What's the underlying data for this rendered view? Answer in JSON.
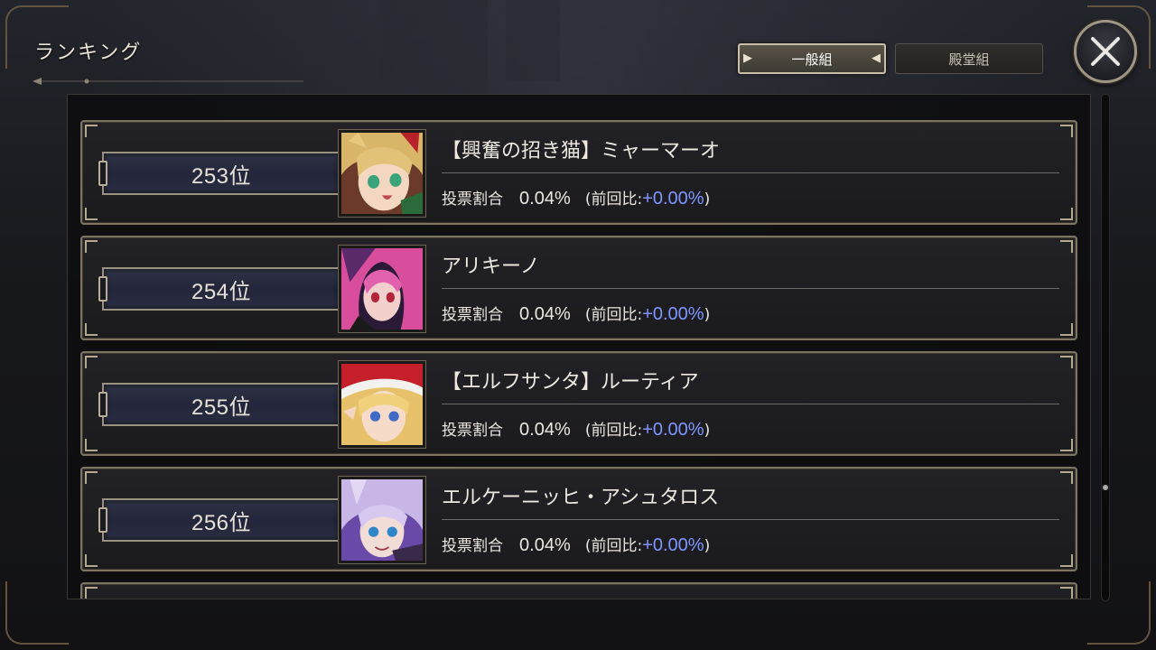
{
  "header": {
    "title": "ランキング",
    "tabs": [
      {
        "label": "一般組",
        "active": true
      },
      {
        "label": "殿堂組",
        "active": false
      }
    ],
    "close_icon": "close-x-icon"
  },
  "colors": {
    "delta_positive": "#7f95ff",
    "frame_gold": "#b4a88e"
  },
  "ranking": [
    {
      "rank": "253位",
      "name": "【興奮の招き猫】ミャーマーオ",
      "vote_label": "投票割合",
      "vote_share": "0.04%",
      "change_prefix": "(前回比:",
      "change": "+0.00%",
      "change_suffix": ")",
      "portrait": "blonde-catgirl-portrait"
    },
    {
      "rank": "254位",
      "name": "アリキーノ",
      "vote_label": "投票割合",
      "vote_share": "0.04%",
      "change_prefix": "(前回比:",
      "change": "+0.00%",
      "change_suffix": ")",
      "portrait": "pink-hair-portrait"
    },
    {
      "rank": "255位",
      "name": "【エルフサンタ】ルーティア",
      "vote_label": "投票割合",
      "vote_share": "0.04%",
      "change_prefix": "(前回比:",
      "change": "+0.00%",
      "change_suffix": ")",
      "portrait": "elf-santa-portrait"
    },
    {
      "rank": "256位",
      "name": "エルケーニッヒ・アシュタロス",
      "vote_label": "投票割合",
      "vote_share": "0.04%",
      "change_prefix": "(前回比:",
      "change": "+0.00%",
      "change_suffix": ")",
      "portrait": "silver-hair-portrait"
    }
  ]
}
